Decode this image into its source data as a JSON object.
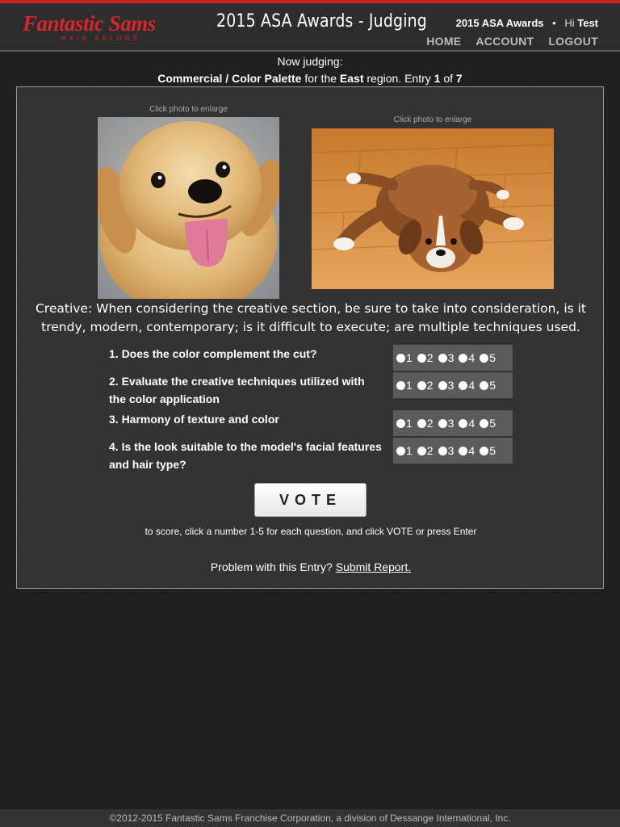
{
  "brand": {
    "logo_main": "Fantastic Sams",
    "logo_sub": "HAIR SALONS"
  },
  "header": {
    "title": "2015 ASA Awards - Judging",
    "awards_label": "2015 ASA Awards",
    "separator": "•",
    "greeting": "Hi",
    "user_name": "Test",
    "nav": [
      "HOME",
      "ACCOUNT",
      "LOGOUT"
    ]
  },
  "judging": {
    "now_label": "Now judging:",
    "category": "Commercial / Color Palette",
    "for_the": "for the",
    "region": "East",
    "region_suffix": "region. Entry",
    "entry_index": "1",
    "of": "of",
    "entry_total": "7"
  },
  "photos": {
    "caption": "Click photo to enlarge"
  },
  "creative_text": "Creative: When considering the creative section, be sure to take into consideration, is it trendy, modern, contemporary; is it difficult to execute; are multiple techniques used.",
  "questions": [
    "1. Does the color complement the cut?",
    "2. Evaluate the creative techniques utilized with the color application",
    "3. Harmony of texture and color",
    "4. Is the look suitable to the model's facial features and hair type?"
  ],
  "score_options": [
    "1",
    "2",
    "3",
    "4",
    "5"
  ],
  "vote_label": "VOTE",
  "hint": "to score, click a number 1-5 for each question, and click VOTE or press Enter",
  "problem": {
    "text": "Problem with this Entry?",
    "link": "Submit Report."
  },
  "footer": "©2012-2015 Fantastic Sams Franchise Corporation, a division of Dessange International, Inc."
}
